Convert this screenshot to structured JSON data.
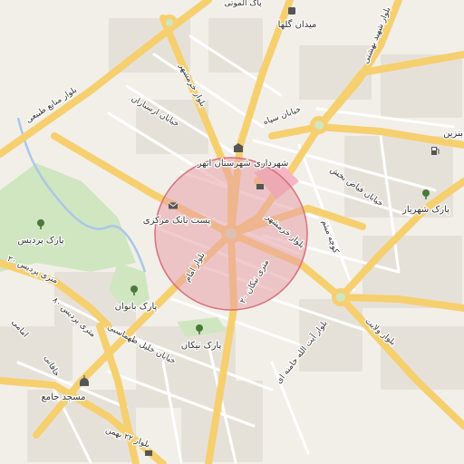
{
  "map": {
    "selection_area": {
      "fill": "#e8a0a8",
      "stroke": "#d9707c"
    },
    "colors": {
      "background": "#f2efe9",
      "major_road": "#f6cf6f",
      "minor_road": "#ffffff",
      "park": "#cfe6c0",
      "water": "#a9c8e8",
      "block": "#e6e1d8"
    },
    "road_labels": [
      "بلوار منابع طبیعی",
      "بلوار خرمشهر",
      "خیابان ارسباران",
      "خیابان سپاه",
      "بلوار شهید بهشتی",
      "خیابان فیاض بخش",
      "بلوار امام",
      "۲۰ متری نیکان",
      "بلوار خرمشهر",
      "کوچه میثم",
      "بلوار ولایت",
      "بلوار آیت الله خامنه ای",
      "خیابان خلیل طهماسبی",
      "۲۰ متری پردیس",
      "۸۰ متری پردیس",
      "امامی",
      "خاقانی",
      "بلوار ۲۲ بهمن",
      "پاک الموتی"
    ],
    "pois": [
      {
        "label": "شهرداری شهرستان ابهر",
        "icon": "government-building-icon"
      },
      {
        "label": "پست بانک مرکزی",
        "icon": "post-office-icon"
      },
      {
        "label": "پارک پردیس",
        "icon": "tree-icon"
      },
      {
        "label": "پارک بانوان",
        "icon": "tree-icon"
      },
      {
        "label": "پارک نیکان",
        "icon": "tree-icon"
      },
      {
        "label": "پارک شهریار",
        "icon": "tree-icon"
      },
      {
        "label": "میدان گلها",
        "icon": "pin-icon"
      },
      {
        "label": "مسجد جامع",
        "icon": "mosque-icon"
      },
      {
        "label": "بنزین",
        "icon": "fuel-icon"
      }
    ]
  }
}
